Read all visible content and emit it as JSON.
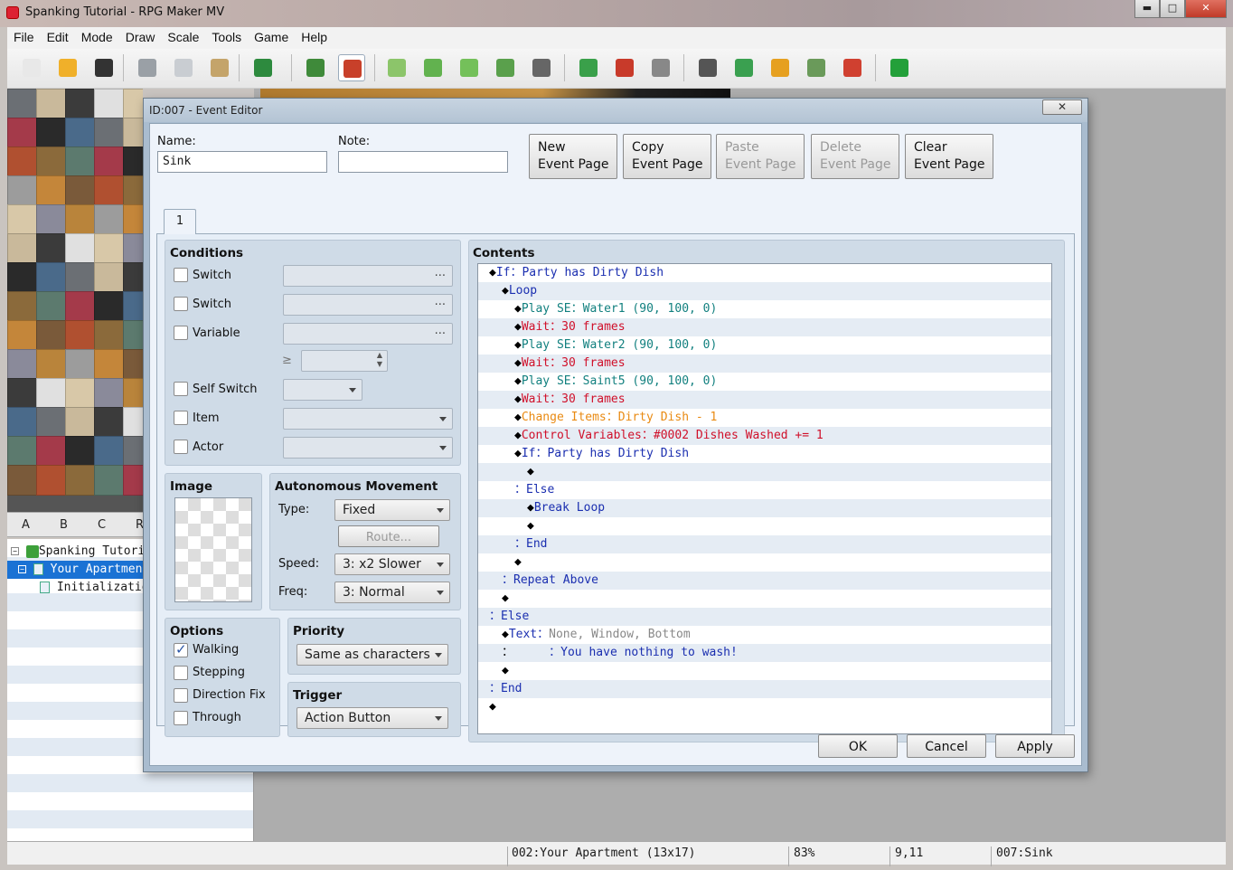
{
  "window": {
    "title": "Spanking Tutorial - RPG Maker MV",
    "min": "▬",
    "max": "□",
    "close": "✕"
  },
  "menu": [
    "File",
    "Edit",
    "Mode",
    "Draw",
    "Scale",
    "Tools",
    "Game",
    "Help"
  ],
  "toolbar": [
    {
      "icon": "new-project-icon",
      "color": "#e8e8e8"
    },
    {
      "icon": "open-project-icon",
      "color": "#f0b02a"
    },
    {
      "icon": "save-project-icon",
      "color": "#333333"
    },
    {
      "icon": "cut-icon",
      "color": "#9aa0a6"
    },
    {
      "icon": "copy-icon",
      "color": "#c9cdd2"
    },
    {
      "icon": "paste-icon",
      "color": "#c4a46a"
    },
    {
      "icon": "undo-icon",
      "color": "#2d8a3e"
    },
    {
      "icon": "map-mode-icon",
      "color": "#3f8a3a"
    },
    {
      "icon": "event-mode-icon",
      "color": "#c8402a"
    },
    {
      "icon": "pencil-icon",
      "color": "#8cc56a"
    },
    {
      "icon": "rectangle-icon",
      "color": "#62b24f"
    },
    {
      "icon": "ellipse-icon",
      "color": "#74c05a"
    },
    {
      "icon": "flood-fill-icon",
      "color": "#5aa04c"
    },
    {
      "icon": "shadow-pen-icon",
      "color": "#666666"
    },
    {
      "icon": "zoom-in-icon",
      "color": "#3aa04a"
    },
    {
      "icon": "zoom-out-icon",
      "color": "#c83a2a"
    },
    {
      "icon": "actual-size-icon",
      "color": "#888888"
    },
    {
      "icon": "database-icon",
      "color": "#555555"
    },
    {
      "icon": "plugin-manager-icon",
      "color": "#3aa050"
    },
    {
      "icon": "sound-test-icon",
      "color": "#e6a020"
    },
    {
      "icon": "event-searcher-icon",
      "color": "#6a9a5a"
    },
    {
      "icon": "character-generator-icon",
      "color": "#d04030"
    },
    {
      "icon": "playtest-icon",
      "color": "#23a03a"
    }
  ],
  "tileTabs": [
    "A",
    "B",
    "C",
    "R"
  ],
  "mapTree": {
    "project": "Spanking Tutorial",
    "maps": [
      "Your Apartment",
      "Initialization"
    ]
  },
  "status": {
    "map": "002:Your Apartment (13x17)",
    "zoom": "83%",
    "coords": "9,11",
    "event": "007:Sink"
  },
  "dialog": {
    "title": "ID:007 - Event Editor",
    "close": "✕",
    "name_label": "Name:",
    "name_value": "Sink",
    "note_label": "Note:",
    "note_value": "",
    "buttons": {
      "new": [
        "New",
        "Event Page"
      ],
      "copy": [
        "Copy",
        "Event Page"
      ],
      "paste": [
        "Paste",
        "Event Page"
      ],
      "delete": [
        "Delete",
        "Event Page"
      ],
      "clear": [
        "Clear",
        "Event Page"
      ]
    },
    "page_tab": "1",
    "conditions": {
      "title": "Conditions",
      "switch1": "Switch",
      "switch2": "Switch",
      "variable": "Variable",
      "gte": "≥",
      "self_switch": "Self Switch",
      "item": "Item",
      "actor": "Actor",
      "dots": "..."
    },
    "image": {
      "title": "Image"
    },
    "movement": {
      "title": "Autonomous Movement",
      "type_label": "Type:",
      "type_value": "Fixed",
      "route": "Route...",
      "speed_label": "Speed:",
      "speed_value": "3: x2 Slower",
      "freq_label": "Freq:",
      "freq_value": "3: Normal"
    },
    "options": {
      "title": "Options",
      "walking": "Walking",
      "walking_checked": true,
      "stepping": "Stepping",
      "direction_fix": "Direction Fix",
      "through": "Through"
    },
    "priority": {
      "title": "Priority",
      "value": "Same as characters"
    },
    "trigger": {
      "title": "Trigger",
      "value": "Action Button"
    },
    "contents_title": "Contents",
    "ok": "OK",
    "cancel": "Cancel",
    "apply": "Apply"
  },
  "contents": [
    {
      "indent": 0,
      "parts": [
        [
          "d",
          "◆"
        ],
        [
          "b",
          "If："
        ],
        [
          "b",
          "Party has Dirty Dish"
        ]
      ]
    },
    {
      "indent": 1,
      "parts": [
        [
          "d",
          "◆"
        ],
        [
          "b",
          "Loop"
        ]
      ]
    },
    {
      "indent": 2,
      "parts": [
        [
          "d",
          "◆"
        ],
        [
          "t",
          "Play SE："
        ],
        [
          "t",
          "Water1 (90, 100, 0)"
        ]
      ]
    },
    {
      "indent": 2,
      "parts": [
        [
          "d",
          "◆"
        ],
        [
          "r",
          "Wait："
        ],
        [
          "r",
          "30 frames"
        ]
      ]
    },
    {
      "indent": 2,
      "parts": [
        [
          "d",
          "◆"
        ],
        [
          "t",
          "Play SE："
        ],
        [
          "t",
          "Water2 (90, 100, 0)"
        ]
      ]
    },
    {
      "indent": 2,
      "parts": [
        [
          "d",
          "◆"
        ],
        [
          "r",
          "Wait："
        ],
        [
          "r",
          "30 frames"
        ]
      ]
    },
    {
      "indent": 2,
      "parts": [
        [
          "d",
          "◆"
        ],
        [
          "t",
          "Play SE："
        ],
        [
          "t",
          "Saint5 (90, 100, 0)"
        ]
      ]
    },
    {
      "indent": 2,
      "parts": [
        [
          "d",
          "◆"
        ],
        [
          "r",
          "Wait："
        ],
        [
          "r",
          "30 frames"
        ]
      ]
    },
    {
      "indent": 2,
      "parts": [
        [
          "d",
          "◆"
        ],
        [
          "o",
          "Change Items："
        ],
        [
          "o",
          "Dirty Dish - 1"
        ]
      ]
    },
    {
      "indent": 2,
      "parts": [
        [
          "d",
          "◆"
        ],
        [
          "r",
          "Control Variables："
        ],
        [
          "r",
          "#0002 Dishes Washed += 1"
        ]
      ]
    },
    {
      "indent": 2,
      "parts": [
        [
          "d",
          "◆"
        ],
        [
          "b",
          "If："
        ],
        [
          "b",
          "Party has Dirty Dish"
        ]
      ]
    },
    {
      "indent": 3,
      "parts": [
        [
          "d",
          "◆"
        ]
      ]
    },
    {
      "indent": 2,
      "parts": [
        [
          "b",
          "：Else"
        ]
      ]
    },
    {
      "indent": 3,
      "parts": [
        [
          "d",
          "◆"
        ],
        [
          "b",
          "Break Loop"
        ]
      ]
    },
    {
      "indent": 3,
      "parts": [
        [
          "d",
          "◆"
        ]
      ]
    },
    {
      "indent": 2,
      "parts": [
        [
          "b",
          "：End"
        ]
      ]
    },
    {
      "indent": 2,
      "parts": [
        [
          "d",
          "◆"
        ]
      ]
    },
    {
      "indent": 1,
      "parts": [
        [
          "b",
          "：Repeat Above"
        ]
      ]
    },
    {
      "indent": 1,
      "parts": [
        [
          "d",
          "◆"
        ]
      ]
    },
    {
      "indent": 0,
      "parts": [
        [
          "b",
          "：Else"
        ]
      ]
    },
    {
      "indent": 1,
      "parts": [
        [
          "d",
          "◆"
        ],
        [
          "b",
          "Text："
        ],
        [
          "g",
          "None, Window, Bottom"
        ]
      ]
    },
    {
      "indent": 1,
      "parts": [
        [
          "d",
          "："
        ],
        [
          "d",
          "     "
        ],
        [
          "b",
          "：You have nothing to wash!"
        ]
      ]
    },
    {
      "indent": 1,
      "parts": [
        [
          "d",
          "◆"
        ]
      ]
    },
    {
      "indent": 0,
      "parts": [
        [
          "b",
          "：End"
        ]
      ]
    },
    {
      "indent": 0,
      "parts": [
        [
          "d",
          "◆"
        ]
      ]
    }
  ]
}
